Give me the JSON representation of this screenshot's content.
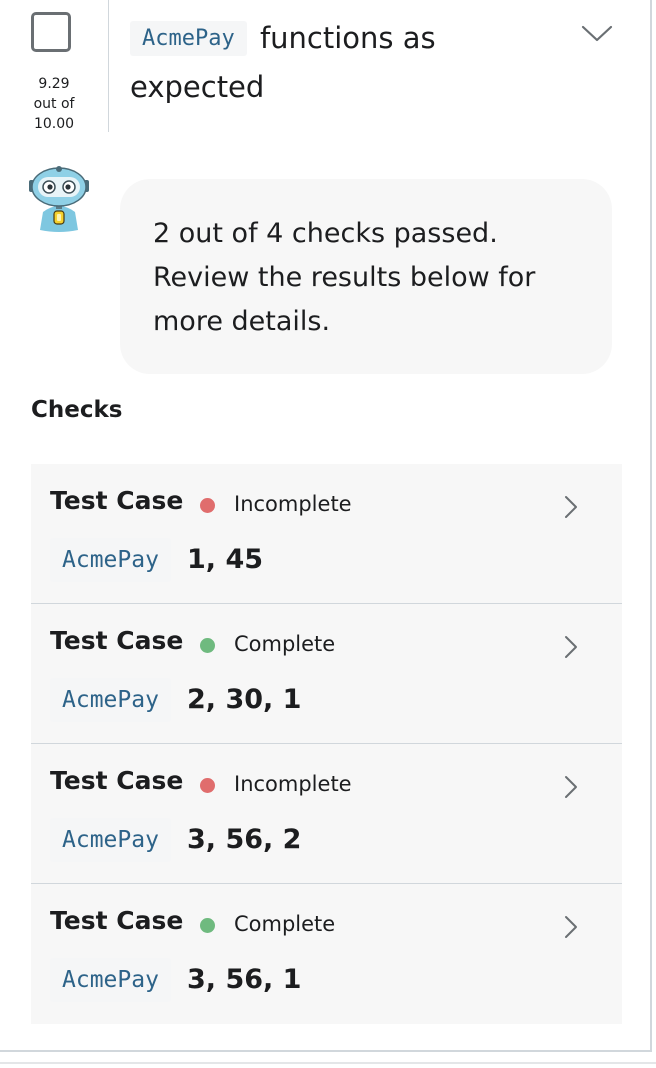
{
  "header": {
    "score_value": "9.29",
    "score_suffix": "out of",
    "score_max": "10.00",
    "title_code": "AcmePay",
    "title_text": "functions as expected"
  },
  "assistant": {
    "icon": "robot-avatar-icon",
    "message": "2 out of 4 checks passed. Review the results below for more details."
  },
  "checks": {
    "heading": "Checks",
    "status_colors": {
      "Incomplete": "#e06d6d",
      "Complete": "#6fba7f"
    },
    "items": [
      {
        "name": "Test Case",
        "status": "Incomplete",
        "code": "AcmePay",
        "args": "1, 45"
      },
      {
        "name": "Test Case",
        "status": "Complete",
        "code": "AcmePay",
        "args": "2, 30, 1"
      },
      {
        "name": "Test Case",
        "status": "Incomplete",
        "code": "AcmePay",
        "args": "3, 56, 2"
      },
      {
        "name": "Test Case",
        "status": "Complete",
        "code": "AcmePay",
        "args": "3, 56, 1"
      }
    ]
  }
}
